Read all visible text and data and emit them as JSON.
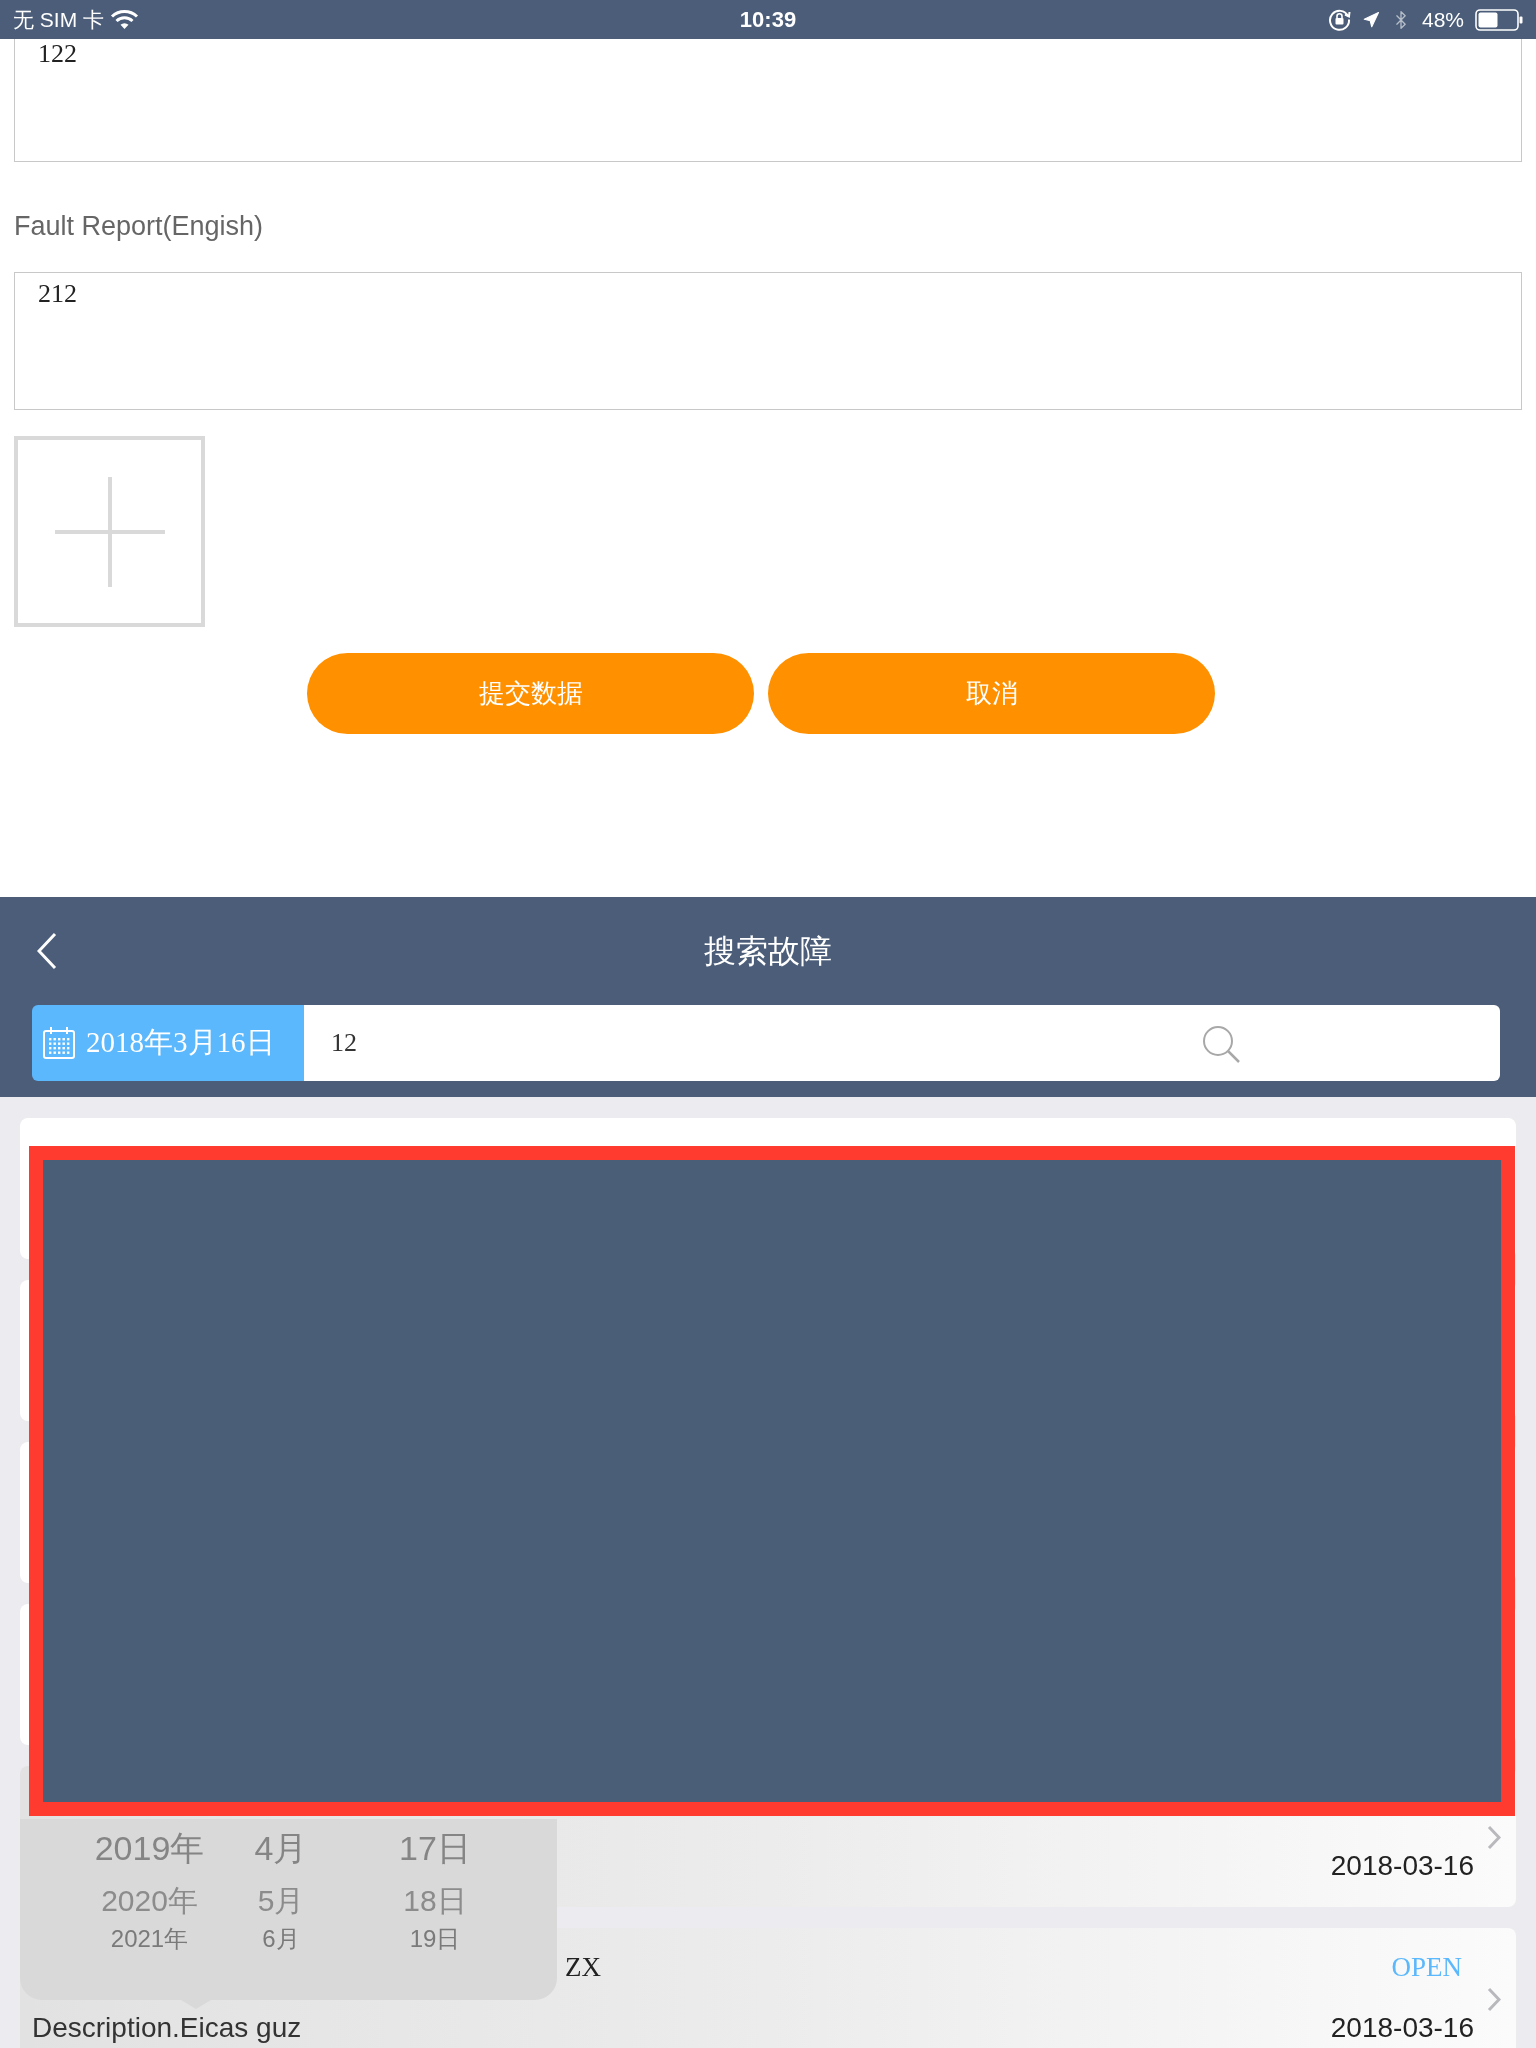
{
  "status_bar": {
    "carrier": "无 SIM 卡",
    "time": "10:39",
    "battery": "48%"
  },
  "form": {
    "fields": [
      {
        "value": "122"
      },
      {
        "label": "Fault Report(Engish)",
        "value": "212"
      }
    ],
    "buttons": [
      "提交数据",
      "取消"
    ]
  },
  "search_screen": {
    "title": "搜索故障",
    "date": "2018年3月16日",
    "query": "12",
    "results": [
      {
        "date": "2018-03-16"
      },
      {
        "text": "ZX",
        "status": "OPEN",
        "description": "Description.Eicas guz",
        "date": "2018-03-16"
      }
    ]
  },
  "date_picker": {
    "rows": [
      [
        "2019年",
        "4月",
        "17日"
      ],
      [
        "2020年",
        "5月",
        "18日"
      ],
      [
        "2021年",
        "6月",
        "19日"
      ]
    ]
  }
}
